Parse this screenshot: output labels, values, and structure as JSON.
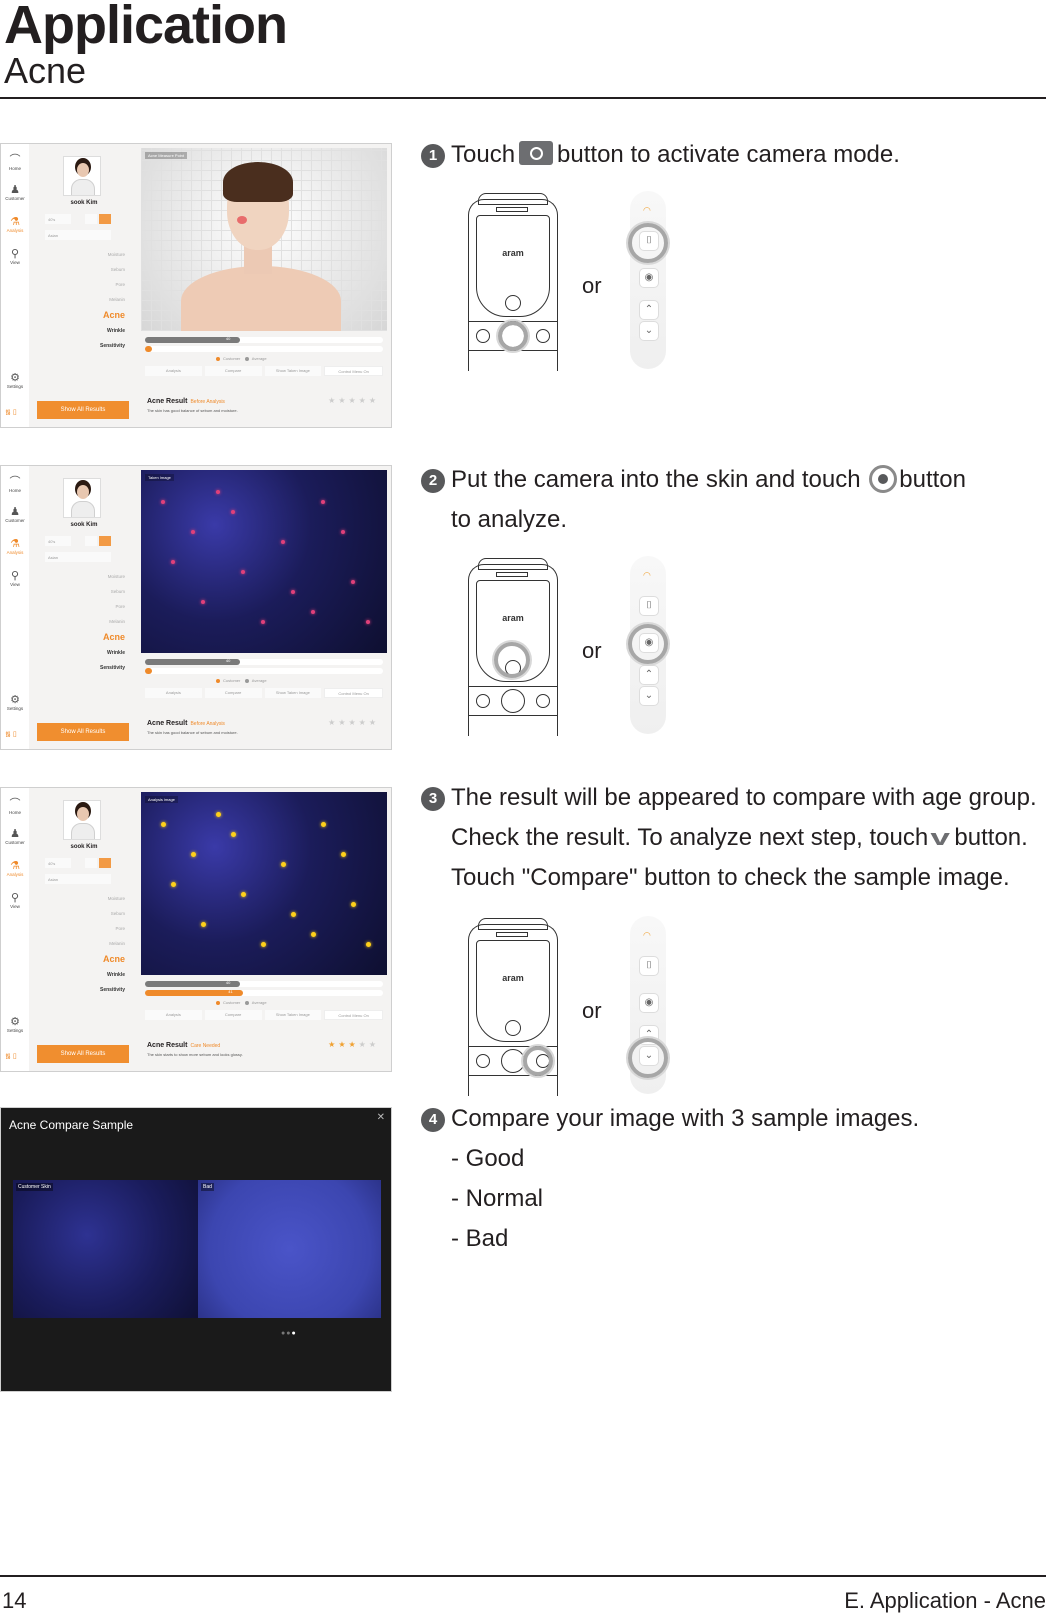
{
  "header": {
    "title": "Application",
    "subtitle": "Acne"
  },
  "app_screens": [
    {
      "nav": [
        "Home",
        "Customer",
        "Analysis",
        "View",
        "Settings"
      ],
      "customer_name": "sook Kim",
      "age_select": "40's",
      "ethnicity_select": "Asian",
      "menu": [
        "Moisture",
        "Sebum",
        "Pore",
        "Melanin",
        "Acne",
        "Wrinkle",
        "Sensitivity"
      ],
      "show_all_label": "Show All Results",
      "viewer_label": "Acne Measure Point",
      "average_bar_value": "40",
      "customer_bar_value": "0",
      "legend": [
        "Customer",
        "Average"
      ],
      "tabs": [
        "Analysis",
        "Compare",
        "Show Taken Image",
        "Control Menu On"
      ],
      "result_title": "Acne Result",
      "result_state": "Before Analysis",
      "result_desc": "The skin has good balance of sebum and moisture.",
      "stars_filled": 0,
      "stars_total": 5
    },
    {
      "nav": [
        "Home",
        "Customer",
        "Analysis",
        "View",
        "Settings"
      ],
      "customer_name": "sook Kim",
      "age_select": "40's",
      "ethnicity_select": "Asian",
      "menu": [
        "Moisture",
        "Sebum",
        "Pore",
        "Melanin",
        "Acne",
        "Wrinkle",
        "Sensitivity"
      ],
      "show_all_label": "Show All Results",
      "viewer_label": "Taken Image",
      "average_bar_value": "40",
      "customer_bar_value": "0",
      "legend": [
        "Customer",
        "Average"
      ],
      "tabs": [
        "Analysis",
        "Compare",
        "Show Taken Image",
        "Control Menu On"
      ],
      "result_title": "Acne Result",
      "result_state": "Before Analysis",
      "result_desc": "The skin has good balance of sebum and moisture.",
      "stars_filled": 0,
      "stars_total": 5
    },
    {
      "nav": [
        "Home",
        "Customer",
        "Analysis",
        "View",
        "Settings"
      ],
      "customer_name": "sook Kim",
      "age_select": "40's",
      "ethnicity_select": "Asian",
      "menu": [
        "Moisture",
        "Sebum",
        "Pore",
        "Melanin",
        "Acne",
        "Wrinkle",
        "Sensitivity"
      ],
      "show_all_label": "Show All Results",
      "viewer_label": "Analysis image",
      "average_bar_value": "40",
      "customer_bar_value": "41",
      "legend": [
        "Customer",
        "Average"
      ],
      "tabs": [
        "Analysis",
        "Compare",
        "Show Taken Image",
        "Control Menu On"
      ],
      "result_title": "Acne Result",
      "result_state": "Care Needed",
      "result_desc": "The skin starts to show more sebum and looks glossy.",
      "stars_filled": 3,
      "stars_total": 5
    }
  ],
  "compare_screen": {
    "title": "Acne Compare Sample",
    "left_label": "Customer Skin",
    "right_label": "Bad",
    "page_dots": 3,
    "current_dot": 3
  },
  "steps": [
    {
      "number": "1",
      "before_icon": "Touch",
      "icon": "camera-icon",
      "after_icon": "button to activate camera mode."
    },
    {
      "number": "2",
      "before_icon": "Put the camera into the skin and touch",
      "icon": "shutter-target-icon",
      "after_icon": "button",
      "line2": "to analyze."
    },
    {
      "number": "3",
      "line1": "The result will be appeared to compare with age group.",
      "line2_before": "Check the result. To analyze next step, touch",
      "icon": "chevron-down-icon",
      "line2_after": "button.",
      "line3": "Touch \"Compare\" button to check the sample image."
    },
    {
      "number": "4",
      "line1": "Compare your image with 3 sample images.",
      "items": [
        "- Good",
        "- Normal",
        "- Bad"
      ]
    }
  ],
  "device": {
    "logo": "aram",
    "or_label": "or"
  },
  "footer": {
    "page_number": "14",
    "section": "E. Application - Acne"
  },
  "colors": {
    "accent": "#ef8a2a",
    "text": "#231f20",
    "step_badge": "#58595b"
  }
}
